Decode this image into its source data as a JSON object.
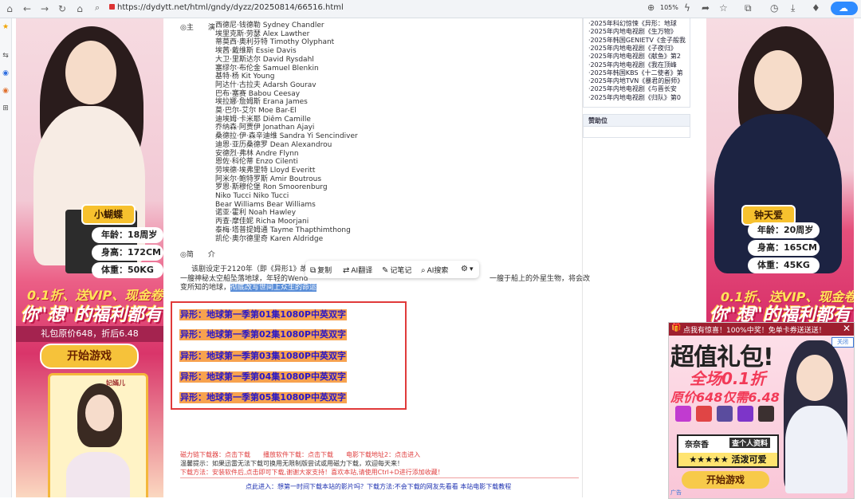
{
  "browser": {
    "url": "https://dydytt.net/html/gndy/dyzz/20250814/66516.html",
    "zoom": "105%"
  },
  "cast": {
    "label": "◎主　　演",
    "names": [
      "西德尼·钱德勒 Sydney Chandler",
      "埃里克斯·劳瑟 Alex Lawther",
      "蒂莫西·奥利芬特 Timothy Olyphant",
      "埃茜·戴维斯 Essie Davis",
      "大卫·里斯达尔 David Rysdahl",
      "塞缪尔·布伦金 Samuel Blenkin",
      "基特·杨 Kit Young",
      "阿达什·古拉夫 Adarsh Gourav",
      "巴布·塞赛 Babou Ceesay",
      "埃拉娜·詹姆斯 Erana James",
      "莫·巴尔-艾尔 Moe Bar-El",
      "迪埃姆·卡米耶 Diêm Camille",
      "乔纳森·阿贾伊 Jonathan Ajayi",
      "桑德拉·伊·森辛迪维 Sandra Yi Sencindiver",
      "迪恩·亚历桑德罗 Dean Alexandrou",
      "安德烈·弗林 Andre Flynn",
      "恩佐·科伦蒂 Enzo Cilenti",
      "劳埃德·埃弗里特 Lloyd Everitt",
      "阿米尔·鲍特罗斯 Amir Boutrous",
      "罗恩·斯穆伦堡 Ron Smoorenburg",
      "Niko Tucci Niko Tucci",
      "Bear Williams Bear Williams",
      "诺亚·霍利 Noah Hawley",
      "丙查·摩佳妮 Richa Moorjani",
      "泰梅·塔普提姆通 Tayme Thapthimthong",
      "凯伦·奥尔德里奇 Karen Aldridge"
    ]
  },
  "intro": {
    "label": "◎简　　介",
    "line1": "该剧设定于2120年（即《异形1》故事",
    "line2_a": "一艘神秘太空船坠落地球，年轻的Wend",
    "line2_b": "一艘于船上的外星生物，将会改",
    "line3_a": "变所知的地球，",
    "line3_sel": "彻底改写世间上众生的命运"
  },
  "toolbar": {
    "copy": "复制",
    "translate": "AI翻译",
    "notes": "记笔记",
    "search": "AI搜索",
    "settings": "▾"
  },
  "downloads": [
    "异形：地球第一季第01集1080P中英双字",
    "异形：地球第一季第02集1080P中英双字",
    "异形：地球第一季第03集1080P中英双字",
    "异形：地球第一季第04集1080P中英双字",
    "异形：地球第一季第05集1080P中英双字"
  ],
  "notes": {
    "line1": "磁力链下载器：点击下载　　播放软件下载：点击下载　　电影下载地址2：点击进入",
    "line2": "温馨提示：如果迅雷无法下载可换用无限制版尝试或用磁力下载，欢迎每天来！",
    "line3": "下载方法：安装软件后,点击即可下载,谢谢大家支持！喜欢本站,请使用Ctrl+D进行添加收藏！",
    "bottom": "点此进入：想第一时间下载本站的影片吗？下载方法:不会下载的网友先看看 本站电影下载教程"
  },
  "sidebar": {
    "items": [
      "·2025年科幻惊悚《异形：地球",
      "·2025年内地电视剧《生万物》",
      "·2025年韩国GENIETV《金子般我",
      "·2025年内地电视剧《子夜归》",
      "·2025年内地电视剧《献鱼》第2",
      "·2025年内地电视剧《我在顶峰",
      "·2025年韩国KBS《十二使者》第",
      "·2025年内地TVN《暴君的厨师》",
      "·2025年内地电视剧《与晋长安",
      "·2025年内地电视剧《归队》第0"
    ],
    "sponsor_title": "赞助位"
  },
  "ad_left": {
    "name": "小蝴蝶",
    "age": "年龄：18周岁",
    "height": "身高：172CM",
    "weight": "体重：50KG",
    "promo1": "0.1折、送VIP、现金卷",
    "promo2": "你\"想\"的福利都有",
    "price": "礼包原价648，折后6.48",
    "button": "开始游戏",
    "card_name": "妃嫣儿"
  },
  "ad_right": {
    "name": "钟天爱",
    "age": "年龄：20周岁",
    "height": "身高：165CM",
    "weight": "体重：45KG",
    "promo1": "0.1折、送VIP、现金卷",
    "promo2": "你\"想\"的福利都有"
  },
  "popup": {
    "title": "点我有惊喜！100%中奖！免单卡券送送送！",
    "close": "关闭",
    "big": "超值礼包!",
    "sub1": "全场0.1折",
    "sub2": "原价648仅需6.48",
    "name": "奈奈香",
    "profile": "查个人资料",
    "tag": "★★★★★ 活泼可爱",
    "button": "开始游戏",
    "ad_label": "广告"
  }
}
